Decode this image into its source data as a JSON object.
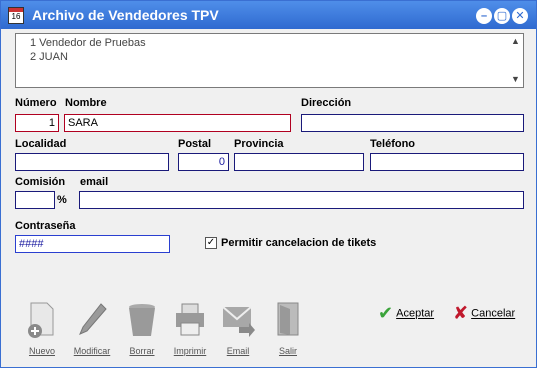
{
  "window": {
    "title": "Archivo de Vendedores TPV",
    "app_icon_text": "16"
  },
  "titlebar_buttons": {
    "minimize": "–",
    "maximize": "▢",
    "close": "✕"
  },
  "list": {
    "items": [
      "1 Vendedor de Pruebas",
      "2 JUAN"
    ]
  },
  "labels": {
    "numero": "Número",
    "nombre": "Nombre",
    "direccion": "Dirección",
    "localidad": "Localidad",
    "postal": "Postal",
    "provincia": "Provincia",
    "telefono": "Teléfono",
    "comision": "Comisión",
    "percent": "%",
    "email": "email",
    "contrasena": "Contraseña"
  },
  "fields": {
    "numero": "1",
    "nombre": "SARA",
    "direccion": "",
    "localidad": "",
    "postal": "0",
    "provincia": "",
    "telefono": "",
    "comision": "",
    "email": "",
    "contrasena": "####"
  },
  "checkbox": {
    "label": "Permitir cancelacion de tikets",
    "checked": true,
    "mark": "✓"
  },
  "toolbar": {
    "nuevo": "Nuevo",
    "modificar": "Modificar",
    "borrar": "Borrar",
    "imprimir": "Imprimir",
    "email": "Email",
    "salir": "Salir"
  },
  "actions": {
    "aceptar": "Aceptar",
    "cancelar": "Cancelar"
  },
  "colors": {
    "titlebar": "#2f6ad0",
    "field_border": "#1a1a7a",
    "accept": "#3aa33a",
    "cancel": "#c0182c"
  }
}
